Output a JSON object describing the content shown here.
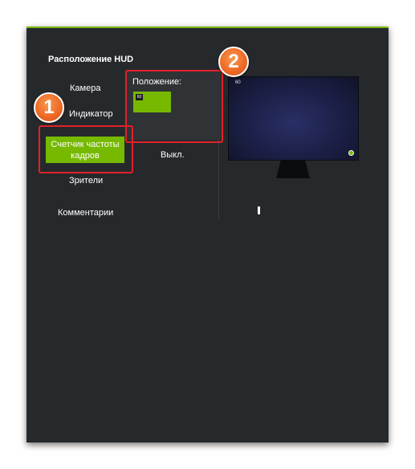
{
  "hud": {
    "title": "Расположение HUD",
    "menu": {
      "camera": "Камера",
      "indicator": "Индикатор",
      "fps_counter": "Счетчик частоты кадров",
      "viewers": "Зрители",
      "comments": "Комментарии"
    },
    "position": {
      "label": "Положение:",
      "selected_fps": "60"
    },
    "status": "Выкл."
  },
  "preview": {
    "fps": "60"
  },
  "annotations": {
    "marker_1": "1",
    "marker_2": "2"
  },
  "colors": {
    "panel_bg": "#26292b",
    "accent_green": "#76b900",
    "highlight_red": "#e4202b",
    "badge_orange": "#ef6a25"
  }
}
